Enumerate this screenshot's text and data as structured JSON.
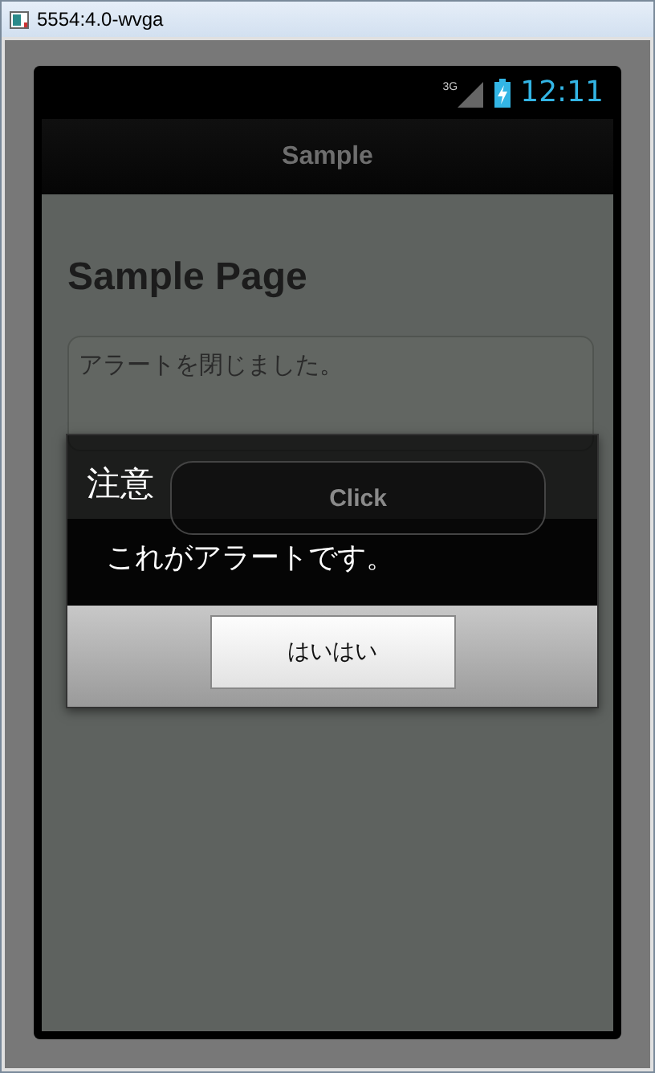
{
  "window": {
    "title": "5554:4.0-wvga"
  },
  "status_bar": {
    "network": "3G",
    "time": "12:11"
  },
  "action_bar": {
    "title": "Sample"
  },
  "page": {
    "heading": "Sample Page",
    "text_area": {
      "value": "アラートを閉じました。"
    },
    "button": "Click"
  },
  "dialog": {
    "title": "注意",
    "message": "これがアラートです。",
    "buttons": [
      "はいはい"
    ]
  }
}
